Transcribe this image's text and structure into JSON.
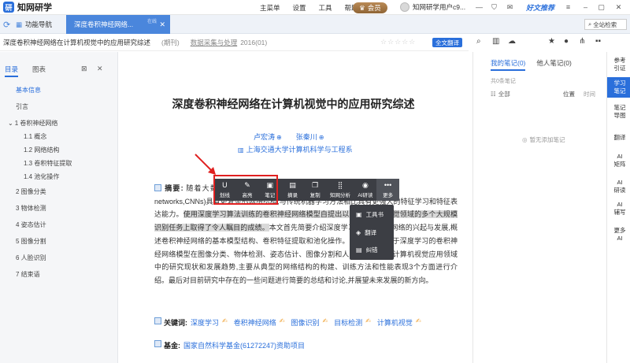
{
  "app": {
    "name": "知网研学",
    "logo_mark": "研"
  },
  "topnav": [
    "主菜单",
    "设置",
    "工具",
    "帮助"
  ],
  "vip_label": "会员",
  "user_name": "知网研学用户c9...",
  "promo": "好文推荐",
  "tabs": {
    "home": "功能导航",
    "active": "深度卷积神经网络...",
    "active_sub": "在线"
  },
  "search_placeholder": "全站检索",
  "doc_header": {
    "title": "深度卷积神经网络在计算机视觉中的应用研究综述",
    "type": "(期刊)",
    "journal": "数据采集与处理",
    "year": "2016(01)",
    "stars": "☆☆☆☆☆",
    "translate": "全文翻译"
  },
  "toc": {
    "tabs": [
      "目录",
      "图表"
    ],
    "items": [
      {
        "label": "基本信息",
        "active": true
      },
      {
        "label": "引言"
      },
      {
        "label": "1 卷积神经网络"
      },
      {
        "label": "1.1 概念"
      },
      {
        "label": "1.2 网络结构"
      },
      {
        "label": "1.3 卷积特征提取"
      },
      {
        "label": "1.4 池化操作"
      },
      {
        "label": "2 图像分类"
      },
      {
        "label": "3 物体检测"
      },
      {
        "label": "4 姿态估计"
      },
      {
        "label": "5 图像分割"
      },
      {
        "label": "6 人脸识别"
      },
      {
        "label": "7 结束语"
      }
    ]
  },
  "paper": {
    "title": "深度卷积神经网络在计算机视觉中的应用研究综述",
    "authors": [
      "卢宏涛",
      "张秦川"
    ],
    "affiliation": "上海交通大学计算机科学与工程系",
    "abstract_label": "摘要:",
    "abstract_pre": "随着大数",
    "abstract_gap1": "据时代的到来,含更多隐含层的深度卷积神经网络(Convolutional neural ",
    "abstract_line2": "networks,CNNs)具有更复杂的网络结构,与传统机器学习方法相比具有更强大的特征学",
    "abstract_line3_pre": "习和特征表达能力。",
    "abstract_hl": "使用深度学习算法训练的卷积神经网络模型自提出以来在计算机视觉领域的多个大规模识别任务上取得了令人瞩目的成绩。",
    "abstract_rest": "本文首先简要介绍深度学习和卷积神经网络的兴起与发展,概述卷积神经网络的基本模型结构、卷积特征提取和池化操作。然后综述了基于深度学习的卷积神经网络模型在图像分类、物体检测、姿态估计、图像分割和人脸识别等多个计算机视觉应用领域中的研究现状和发展趋势,主要从典型的网络结构的构建、训练方法和性能表现3个方面进行介绍。最后对目前研究中存在的一些问题进行简要的总结和讨论,并展望未来发展的新方向。",
    "keywords_label": "关键词:",
    "keywords": [
      "深度学习",
      "卷积神经网络",
      "图像识别",
      "目标检测",
      "计算机视觉"
    ],
    "fund_label": "基金:",
    "fund": "国家自然科学基金(61272247)资助项目"
  },
  "float_toolbar": [
    {
      "icon": "U",
      "label": "划线"
    },
    {
      "icon": "✎",
      "label": "高亮"
    },
    {
      "icon": "▣",
      "label": "笔记"
    },
    {
      "icon": "▤",
      "label": "摘录"
    },
    {
      "icon": "❐",
      "label": "复制"
    },
    {
      "icon": "⣿",
      "label": "知网分析"
    },
    {
      "icon": "◉",
      "label": "AI研读"
    },
    {
      "icon": "•••",
      "label": "更多"
    }
  ],
  "more_menu": [
    {
      "icon": "▣",
      "label": "工具书"
    },
    {
      "icon": "◈",
      "label": "翻译"
    },
    {
      "icon": "▤",
      "label": "纠错"
    }
  ],
  "notes": {
    "tabs": [
      "我的笔记(0)",
      "他人笔记(0)"
    ],
    "count": "共0条笔记",
    "filter": "全部",
    "sort_pos": "位置",
    "sort_time": "时间",
    "empty": "暂无添加笔记"
  },
  "rail": [
    "参考\n引证",
    "学习\n笔记",
    "笔记\n导图",
    "翻译",
    "AI\n矩阵",
    "AI\n研读",
    "AI\n辅写",
    "更多\nAI"
  ],
  "colors": {
    "accent": "#2a6fdb",
    "highlight_box": "#e02020",
    "toolbar_bg": "#3c3e44"
  }
}
